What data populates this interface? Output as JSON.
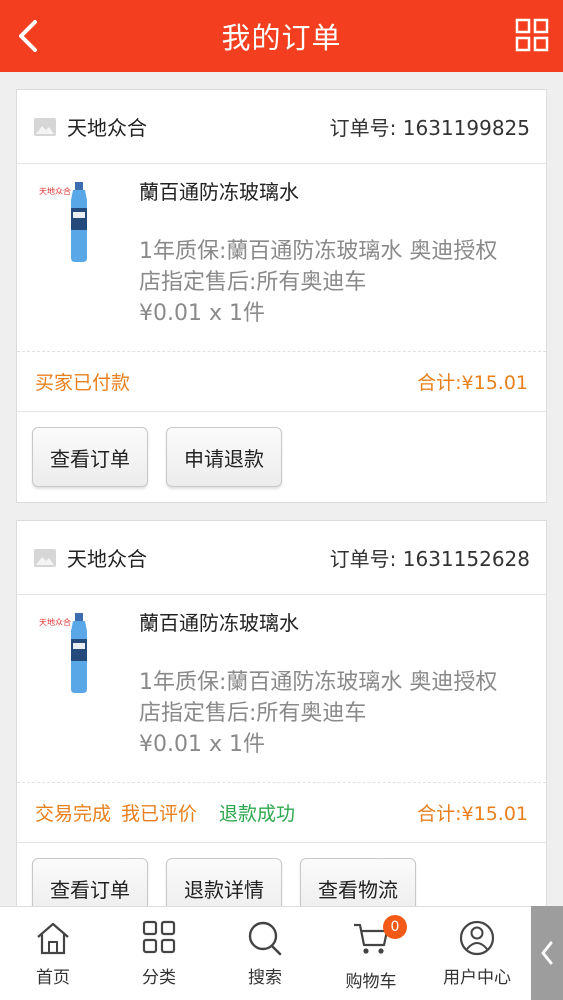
{
  "header": {
    "title": "我的订单",
    "back_icon": "chevron-left-icon",
    "menu_icon": "grid-icon"
  },
  "orders": [
    {
      "store": "天地众合",
      "order_no": "订单号: 1631199825",
      "product_name": "蘭百通防冻玻璃水",
      "product_desc": "1年质保:蘭百通防冻玻璃水 奥迪授权店指定售后:所有奥迪车",
      "price_qty": "¥0.01 x 1件",
      "status": "买家已付款",
      "total": "合计:¥15.01",
      "buttons": [
        "查看订单",
        "申请退款"
      ]
    },
    {
      "store": "天地众合",
      "order_no": "订单号: 1631152628",
      "product_name": "蘭百通防冻玻璃水",
      "product_desc": "1年质保:蘭百通防冻玻璃水 奥迪授权店指定售后:所有奥迪车",
      "price_qty": "¥0.01 x 1件",
      "status": "交易完成",
      "status2": "我已评价",
      "status3": "退款成功",
      "total": "合计:¥15.01",
      "buttons": [
        "查看订单",
        "退款详情",
        "查看物流"
      ]
    }
  ],
  "tabbar": {
    "items": [
      {
        "label": "首页",
        "icon": "home-icon"
      },
      {
        "label": "分类",
        "icon": "category-icon"
      },
      {
        "label": "搜索",
        "icon": "search-icon"
      },
      {
        "label": "购物车",
        "icon": "cart-icon",
        "badge": "0"
      },
      {
        "label": "用户中心",
        "icon": "user-icon"
      }
    ]
  },
  "colors": {
    "header": "#f33f1f",
    "status_orange": "#e8801e",
    "status_green": "#2da84f",
    "badge": "#f35a17"
  }
}
